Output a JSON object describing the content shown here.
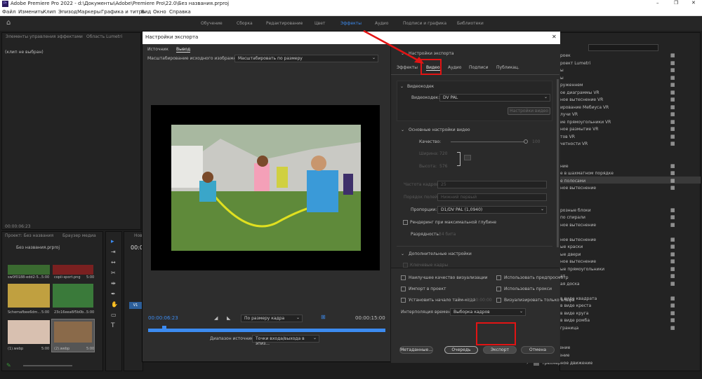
{
  "app": {
    "title": "Adobe Premiere Pro 2022 - d:\\Документы\\Adobe\\Premiere Pro\\22.0\\Без названия.prproj",
    "logo": "Pr"
  },
  "menu": [
    "Файл",
    "Изменить",
    "Клип",
    "Эпизод",
    "Маркеры",
    "Графика и титры",
    "Вид",
    "Окно",
    "Справка"
  ],
  "workspaces": [
    "Обучение",
    "Сборка",
    "Редактирование",
    "Цвет",
    "Эффекты",
    "Аудио",
    "Подписи и графика",
    "Библиотеки"
  ],
  "left": {
    "tab1": "Элементы управления эффектами",
    "tab2": "Область Lumetri",
    "empty": "(клип не выбран)",
    "timecode": "00:00:06:23"
  },
  "project": {
    "tab1": "Проект: Без названия",
    "tab2": "Браузер медиа",
    "file": "Без названия.prproj",
    "items": [
      {
        "name": "sw0f0188-edd2-5...",
        "dur": "5:00"
      },
      {
        "name": "copii-sport.png",
        "dur": "5:00"
      },
      {
        "name": "Schemafbee6dm...",
        "dur": "5:00"
      },
      {
        "name": "23c16eea6f5b0b...",
        "dur": "5:00"
      },
      {
        "name": "(1).webp",
        "dur": "5:00"
      },
      {
        "name": "(2).webp",
        "dur": "5:00"
      }
    ]
  },
  "timeline": {
    "tc": "00:00",
    "v1": "V1",
    "label": "Нов"
  },
  "effects": {
    "items": [
      "роек",
      "роект Lumetri",
      "ы",
      "ы",
      "руженнем",
      "ое диаграммы VR",
      "ное вытеснение VR",
      "ирование Мебиуса VR",
      "лучи VR",
      "ие прямоугольники VR",
      "ное размытие VR",
      "тов VR",
      "четности VR",
      "",
      "",
      "ние",
      "е в шахматном порядке",
      "е полосами",
      "ное вытеснение",
      "",
      "",
      "розные блоки",
      "по спирали",
      "ное вытеснение",
      "",
      "ное вытеснение",
      "ые краски",
      "ые двери",
      "ное вытеснение",
      "ые прямоугольники",
      "ат",
      "ая доска",
      "",
      "в виде квадрата",
      "в виде креста",
      "в виде круга",
      "в виде ромба",
      "граница"
    ],
    "folders": [
      "Растворение",
      "Скольжение",
      "Трехмерное движение"
    ]
  },
  "dialog": {
    "title": "Настройки экспорта",
    "close": "✕",
    "tab_source": "Источник",
    "tab_output": "Вывод",
    "scale_label": "Масштабирование исходного изображения:",
    "scale_value": "Масштабировать по размеру",
    "tc_in": "00:00:06:23",
    "tc_out": "00:00:15:00",
    "fit": "По размеру кадра",
    "range_label": "Диапазон источника:",
    "range_value": "Точки входа/выхода в эпиз...",
    "export_settings": "Настройки экспорта",
    "tabs": [
      "Эффекты",
      "Видео",
      "Аудио",
      "Подписи",
      "Публикац."
    ],
    "video_codec_head": "Видеокодек",
    "codec_label": "Видеокодек:",
    "codec_value": "DV PAL",
    "codec_settings": "Настройки видео",
    "basic_head": "Основные настройки видео",
    "quality_label": "Качество:",
    "quality_value": "100",
    "width_label": "Ширина:",
    "width_value": "720",
    "height_label": "Высота:",
    "height_value": "576",
    "fps_label": "Частота кадров:",
    "fps_value": "25",
    "field_label": "Порядок полей:",
    "field_value": "Нижний первый",
    "aspect_label": "Пропорции:",
    "aspect_value": "D1/DV PAL (1,0940)",
    "maxdepth": "Рендеринг при максимальной глубине",
    "bitdepth_label": "Разрядность:",
    "bitdepth_value": "24 бита",
    "extra_head": "Дополнительные настройки",
    "keyframes": "Ключевые кадры",
    "cb_left": [
      "Наилучшее качество визуализации",
      "Импорт в проект",
      "Установить начало тайм-кода"
    ],
    "tc_start": "00:00:00:00",
    "cb_right": [
      "Использовать предпросмотр",
      "Использовать прокси",
      "Визуализировать только альфа"
    ],
    "interp_label": "Интерполяция времени:",
    "interp_value": "Выборка кадров",
    "btn_meta": "Метаданные...",
    "btn_queue": "Очередь",
    "btn_export": "Экспорт",
    "btn_cancel": "Отмена"
  },
  "colors": {
    "accent": "#3c8bf0",
    "highlight": "#e21414"
  }
}
